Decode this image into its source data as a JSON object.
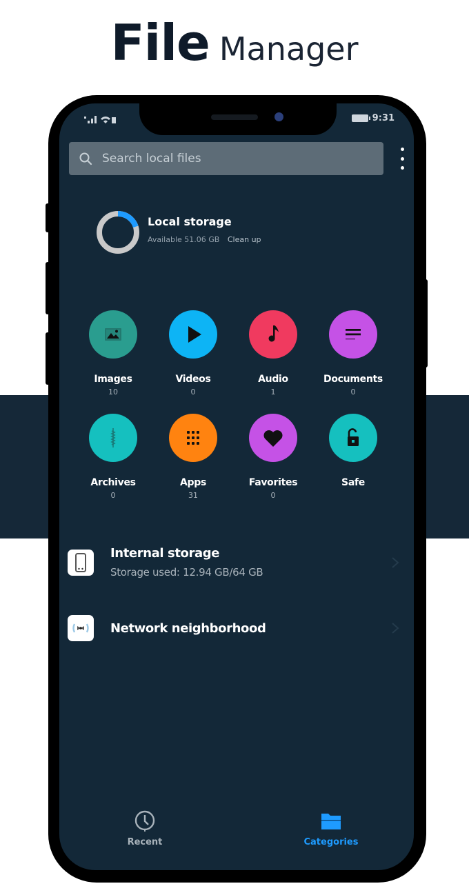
{
  "promo": {
    "title_bold": "File",
    "title_light": "Manager"
  },
  "status_bar": {
    "left_indicators": "ᵗ▁▃▅ ᵁᴼ",
    "time": "9:31"
  },
  "search": {
    "placeholder": "Search local files",
    "value": ""
  },
  "storage": {
    "title": "Local storage",
    "available": "Available 51.06 GB",
    "cleanup_label": "Clean up",
    "used_fraction": 0.2,
    "ring_used_color": "#1e9bff",
    "ring_track_color": "#c9c9c9"
  },
  "categories": [
    {
      "label": "Images",
      "count": "10",
      "icon": "image-icon",
      "color": "#2a9d8f"
    },
    {
      "label": "Videos",
      "count": "0",
      "icon": "play-icon",
      "color": "#0db4f5"
    },
    {
      "label": "Audio",
      "count": "1",
      "icon": "music-note-icon",
      "color": "#f03a5f"
    },
    {
      "label": "Documents",
      "count": "0",
      "icon": "document-icon",
      "color": "#c552e6"
    },
    {
      "label": "Archives",
      "count": "0",
      "icon": "zip-icon",
      "color": "#15c0bf"
    },
    {
      "label": "Apps",
      "count": "31",
      "icon": "grid-icon",
      "color": "#ff8310"
    },
    {
      "label": "Favorites",
      "count": "0",
      "icon": "heart-icon",
      "color": "#c552e6"
    },
    {
      "label": "Safe",
      "count": "",
      "icon": "lock-icon",
      "color": "#15c0bf"
    }
  ],
  "locations": [
    {
      "title": "Internal storage",
      "subtitle": "Storage used: 12.94 GB/64 GB",
      "icon": "phone-storage-icon"
    },
    {
      "title": "Network neighborhood",
      "subtitle": "",
      "icon": "network-icon"
    }
  ],
  "bottom_nav": {
    "tabs": [
      {
        "label": "Recent",
        "icon": "clock-icon",
        "active": false,
        "color": "#a9b3bb"
      },
      {
        "label": "Categories",
        "icon": "folder-icon",
        "active": true,
        "color": "#1e9bff"
      }
    ]
  },
  "colors": {
    "background_dark": "#132838",
    "accent": "#1e9bff"
  }
}
